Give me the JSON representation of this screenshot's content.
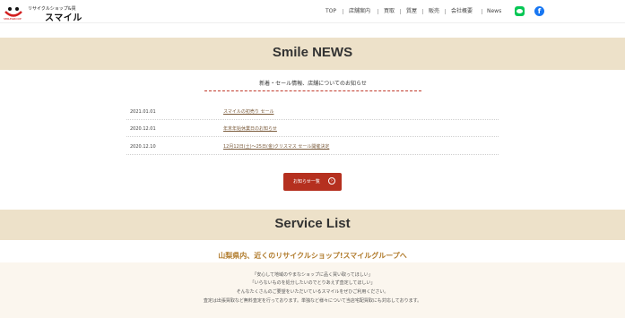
{
  "header": {
    "logo_tagline": "リサイクルショップ&買",
    "logo_name": "スマイル",
    "logo_group": "SMILEGROUP",
    "nav": [
      "TOP",
      "店舗案内",
      "買取",
      "質屋",
      "販売",
      "会社概要",
      "News"
    ]
  },
  "news": {
    "title": "Smile NEWS",
    "subtitle": "新着・セール情報、店舗についてのお知らせ",
    "items": [
      {
        "date": "2021.01.01",
        "text": "スマイルの初売り セール"
      },
      {
        "date": "2020.12.01",
        "text": "年末年始休業日のお知らせ"
      },
      {
        "date": "2020.12.10",
        "text": "12月12日(土)〜25日(金)クリスマス セール開催決定"
      }
    ],
    "more_label": "お知らせ一覧"
  },
  "service": {
    "title": "Service List",
    "lead": "山梨県内、近くのリサイクルショップ!スマイルグループへ",
    "lines": [
      "「安心して地域のやまなショップに品く買い取ってほしい」",
      "「いらないものを処分したいのでとりあえず査定してほしい」",
      "そんなたくさんのご要望をいただいているスマイルをぜひご利用ください。",
      "査定は出張買取など無料査定を行っております。単独など様々について当店宅配買取にも対応しております。"
    ]
  }
}
